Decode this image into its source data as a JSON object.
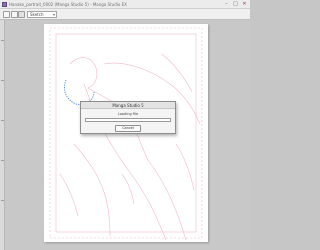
{
  "window": {
    "title": "Hanako_portrait_0002 (Manga Studio 5) - Manga Studio EX",
    "controls": {
      "minimize": "–",
      "maximize": "□",
      "close": "✕"
    }
  },
  "toolbar": {
    "icons": [
      "hand-tool-icon",
      "zoom-tool-icon",
      "layer-tool-icon"
    ],
    "layer_select_value": "Sketch"
  },
  "dialog": {
    "title": "Manga Studio 5",
    "message": "Loading file",
    "cancel_label": "Cancel",
    "progress_fraction": 0.0
  },
  "colors": {
    "sketch_line": "#f2b8c6",
    "accent_blue": "#3f7fd6",
    "page": "#ffffff",
    "workspace": "#c8c8c8"
  }
}
